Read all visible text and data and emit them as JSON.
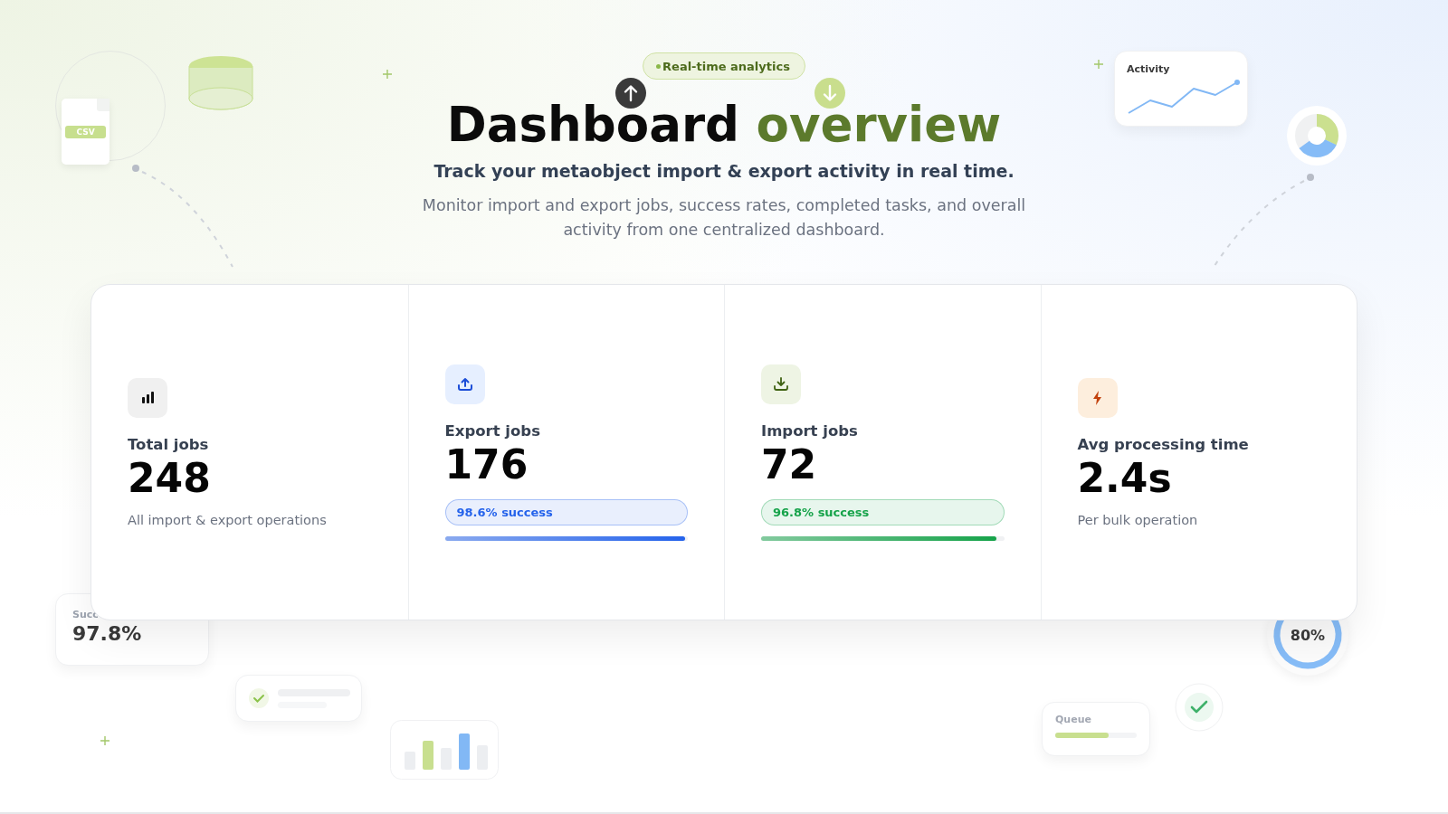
{
  "badge": {
    "label": "Real-time analytics"
  },
  "hero": {
    "title": "Dashboard",
    "title_accent": "overview",
    "subtitle": "Track your metaobject import & export activity in real time.",
    "description": "Monitor import and export jobs, success rates, completed tasks, and overall activity from one centralized dashboard."
  },
  "stats": [
    {
      "kind": "plain",
      "label": "Total jobs",
      "value": "248",
      "caption": "All import & export operations"
    },
    {
      "kind": "progress",
      "label": "Export jobs",
      "value": "176",
      "pill": "98.6% success",
      "color": "#2563eb",
      "level": 0.99
    },
    {
      "kind": "progress",
      "label": "Import jobs",
      "value": "72",
      "pill": "96.8% success",
      "color": "#16a34a",
      "level": 0.97
    },
    {
      "kind": "plain",
      "label": "Avg processing time",
      "value": "2.4s",
      "caption": "Per bulk operation"
    }
  ],
  "floating": {
    "csv_file": {
      "label": "CSV"
    },
    "activity_card": {
      "title": "Activity"
    },
    "success_card": {
      "label": "Succ",
      "value": "97.8%"
    },
    "progress_ring": {
      "value": "80%"
    },
    "queue_card": {
      "label": "Queue",
      "level": 0.65
    }
  }
}
